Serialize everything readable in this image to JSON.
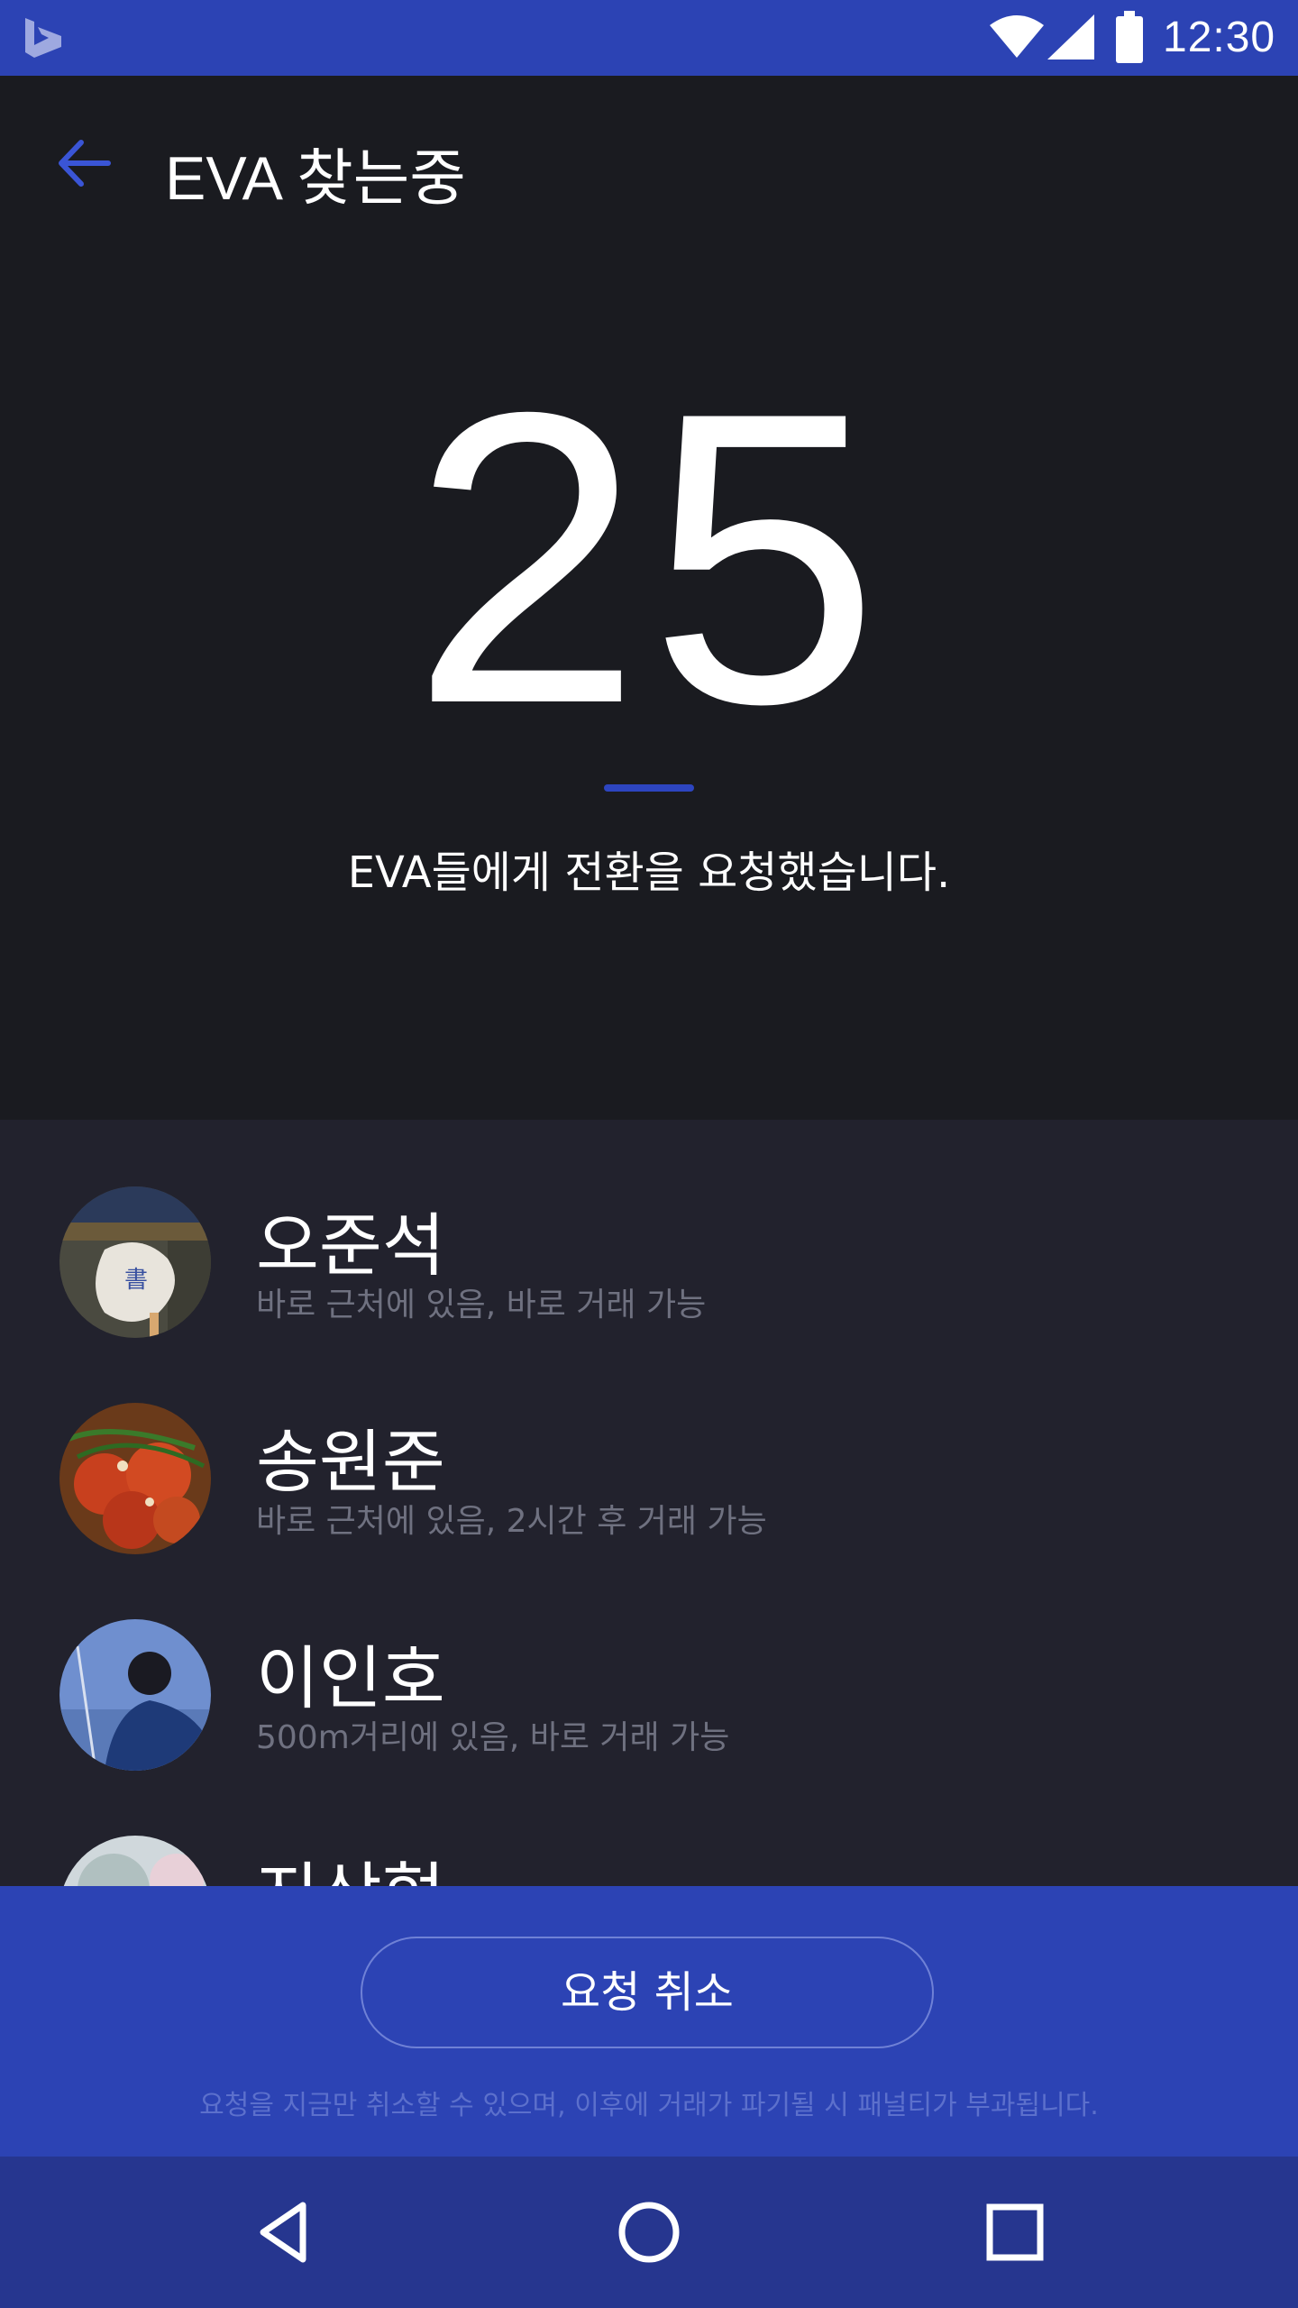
{
  "status_bar": {
    "time": "12:30",
    "icons": [
      "bing-icon",
      "wifi-icon",
      "cell-signal-icon",
      "battery-icon"
    ]
  },
  "header": {
    "title": "EVA 찾는중",
    "back_icon": "arrow-left-icon",
    "countdown": "25",
    "message": "EVA들에게 전환을 요청했습니다."
  },
  "eva_list": [
    {
      "name": "오준석",
      "status": "바로 근처에 있음, 바로 거래 가능"
    },
    {
      "name": "송원준",
      "status": "바로 근처에 있음, 2시간 후 거래 가능"
    },
    {
      "name": "이인호",
      "status": "500m거리에 있음, 바로 거래 가능"
    },
    {
      "name": "지상혁",
      "status": ""
    }
  ],
  "footer": {
    "cancel_label": "요청 취소",
    "note": "요청을 지금만 취소할 수 있으며, 이후에 거래가 파기될 시 패널티가 부과됩니다."
  },
  "nav_bar": {
    "icons": [
      "back-triangle-icon",
      "home-circle-icon",
      "recents-square-icon"
    ]
  },
  "colors": {
    "accent": "#2c43b4",
    "header_bg": "#1a1b20",
    "list_bg": "#22222d",
    "nav_bg": "#26368f",
    "secondary_text": "#6f7180"
  }
}
